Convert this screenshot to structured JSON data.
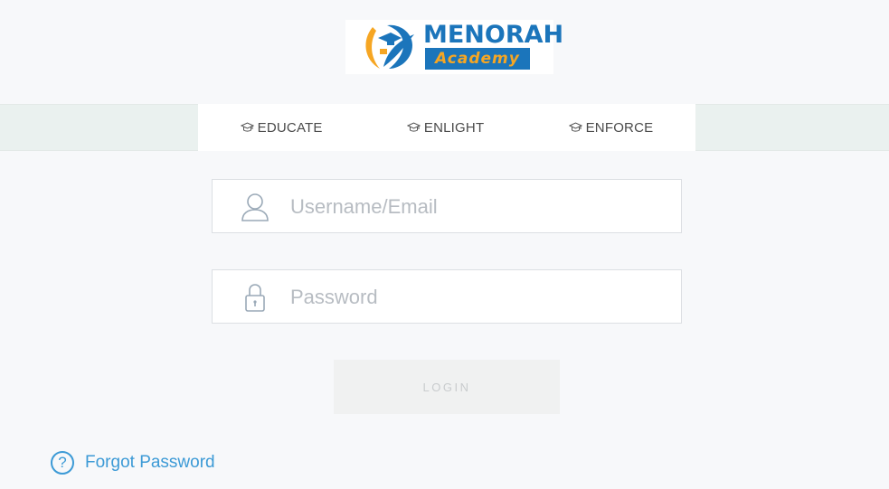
{
  "logo": {
    "name": "MENORAH",
    "subtitle": "Academy"
  },
  "nav": {
    "items": [
      {
        "label": "EDUCATE",
        "icon": "graduation-cap-icon"
      },
      {
        "label": "ENLIGHT",
        "icon": "graduation-cap-icon"
      },
      {
        "label": "ENFORCE",
        "icon": "graduation-cap-icon"
      }
    ]
  },
  "form": {
    "username": {
      "placeholder": "Username/Email",
      "value": "",
      "icon": "user-icon"
    },
    "password": {
      "placeholder": "Password",
      "value": "",
      "icon": "lock-icon"
    },
    "login_label": "LOGIN"
  },
  "forgot": {
    "label": "Forgot Password",
    "icon_glyph": "?",
    "icon": "help-circle-icon"
  },
  "colors": {
    "brand_blue": "#1b75bb",
    "brand_orange": "#f6a623",
    "link_blue": "#3c9ad6",
    "band_bg": "#eaf1ef",
    "page_bg": "#f7f8fa"
  }
}
